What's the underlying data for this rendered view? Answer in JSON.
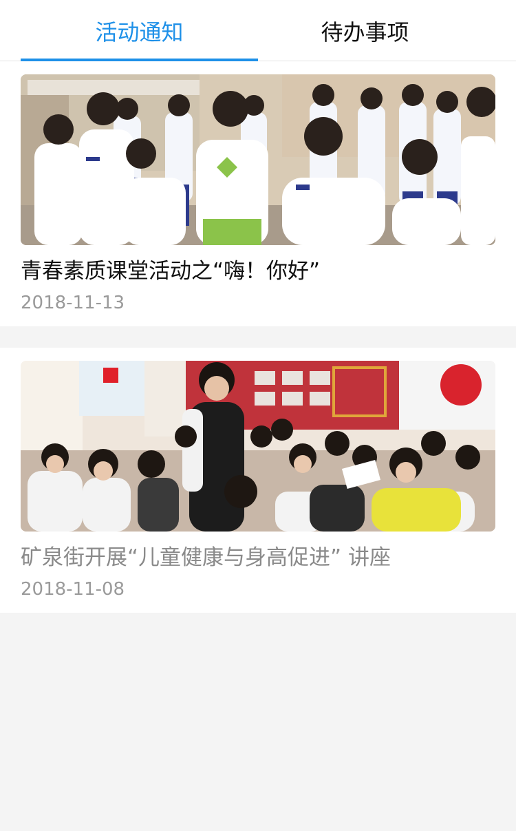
{
  "tabs": [
    {
      "label": "活动通知",
      "active": true
    },
    {
      "label": "待办事项",
      "active": false
    }
  ],
  "colors": {
    "accent": "#1e90e8",
    "background": "#f4f4f4",
    "card": "#ffffff"
  },
  "activities": [
    {
      "title": "青春素质课堂活动之“嗨！你好”",
      "date": "2018-11-13"
    },
    {
      "title": "矿泉街开展“儿童健康与身高促进” 讲座",
      "date": "2018-11-08"
    }
  ]
}
